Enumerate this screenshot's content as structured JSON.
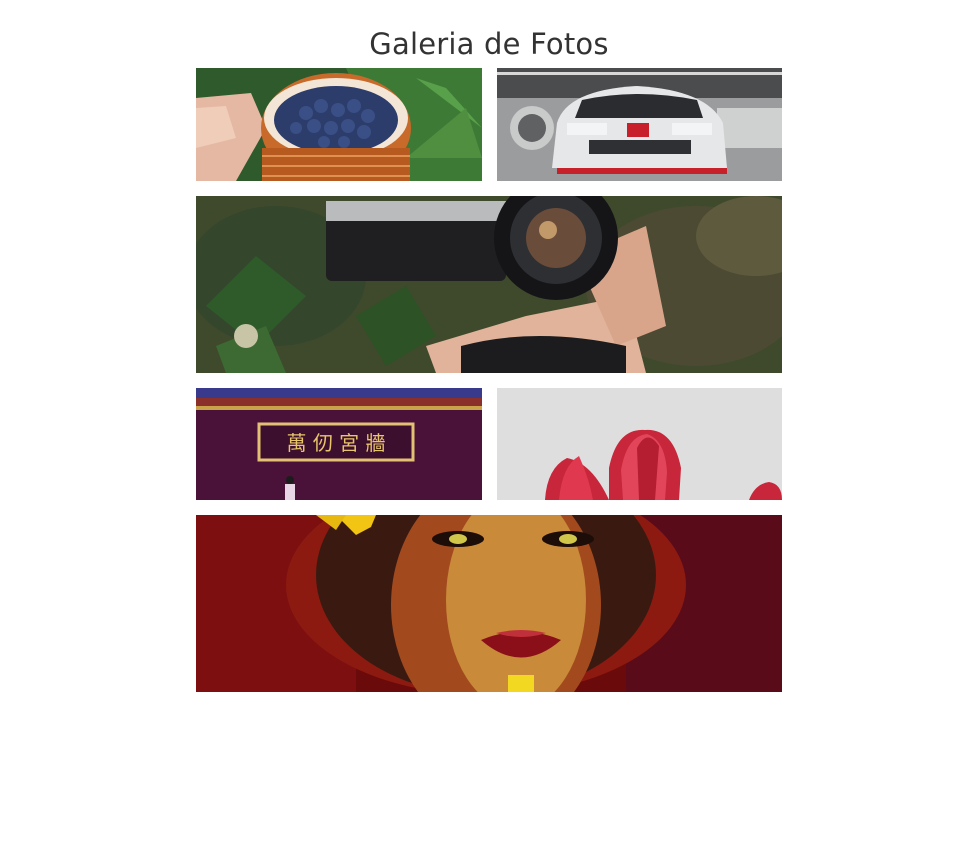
{
  "page": {
    "title": "Galeria de Fotos"
  },
  "colors": {
    "background": "#ffffff",
    "title_text": "#333333"
  },
  "gallery": {
    "photos": [
      {
        "id": "blueberries",
        "subject": "hand holding a cup of blueberries"
      },
      {
        "id": "car",
        "subject": "white Honda car in a garage"
      },
      {
        "id": "camera",
        "subject": "hand holding a vintage camera over leaves"
      },
      {
        "id": "temple",
        "subject": "purple temple facade with golden sign",
        "sign_text": "萬 仞 宮 牆"
      },
      {
        "id": "tulips",
        "subject": "red tulips on light grey background"
      },
      {
        "id": "portrait",
        "subject": "woman portrait in red and gold light"
      }
    ]
  }
}
